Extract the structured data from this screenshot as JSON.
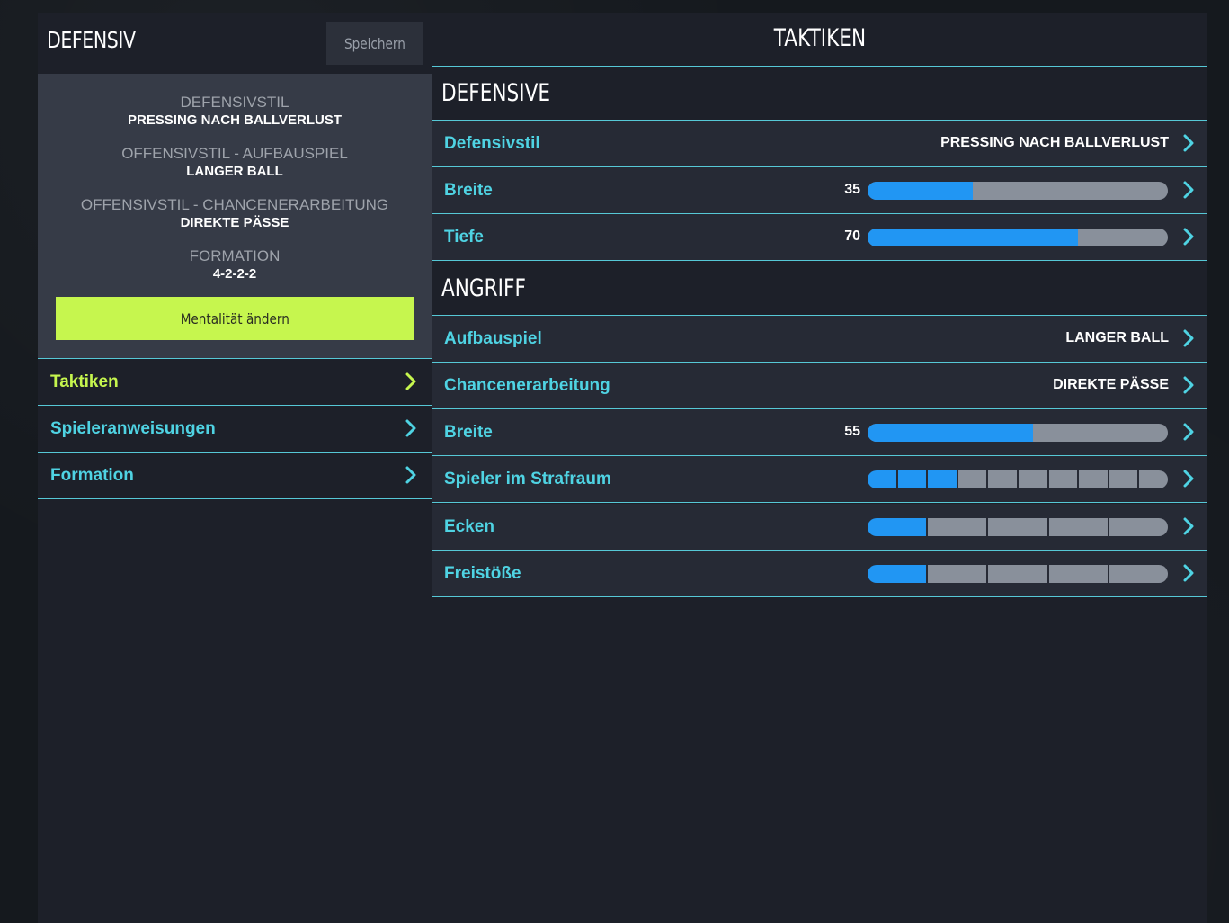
{
  "left": {
    "title": "DEFENSIV",
    "save_label": "Speichern",
    "summary": [
      {
        "label": "DEFENSIVSTIL",
        "value": "PRESSING NACH BALLVERLUST"
      },
      {
        "label": "OFFENSIVSTIL - AUFBAUSPIEL",
        "value": "LANGER BALL"
      },
      {
        "label": "OFFENSIVSTIL - CHANCENERARBEITUNG",
        "value": "DIREKTE PÄSSE"
      },
      {
        "label": "FORMATION",
        "value": "4-2-2-2"
      }
    ],
    "mentality_label": "Mentalität ändern",
    "nav": [
      {
        "label": "Taktiken",
        "active": true
      },
      {
        "label": "Spieleranweisungen",
        "active": false
      },
      {
        "label": "Formation",
        "active": false
      }
    ]
  },
  "right": {
    "title": "TAKTIKEN",
    "defensive": {
      "heading": "DEFENSIVE",
      "defensivstil": {
        "label": "Defensivstil",
        "value": "PRESSING NACH BALLVERLUST"
      },
      "breite": {
        "label": "Breite",
        "value": "35",
        "fraction": 0.35
      },
      "tiefe": {
        "label": "Tiefe",
        "value": "70",
        "fraction": 0.7
      }
    },
    "angriff": {
      "heading": "ANGRIFF",
      "aufbauspiel": {
        "label": "Aufbauspiel",
        "value": "LANGER BALL"
      },
      "chancen": {
        "label": "Chancenerarbeitung",
        "value": "DIREKTE PÄSSE"
      },
      "breite": {
        "label": "Breite",
        "value": "55",
        "fraction": 0.55
      },
      "strafraum": {
        "label": "Spieler im Strafraum",
        "level": 3,
        "segments": 10
      },
      "ecken": {
        "label": "Ecken",
        "level": 1,
        "segments": 5
      },
      "freistoesse": {
        "label": "Freistöße",
        "level": 1,
        "segments": 5
      }
    }
  },
  "colors": {
    "accent_cyan": "#4fd3e3",
    "accent_lime": "#c6f64e",
    "slider_blue": "#2196f3",
    "slider_gray": "#89909b"
  },
  "icons": {
    "row_chevron": "chevron-right-icon"
  }
}
